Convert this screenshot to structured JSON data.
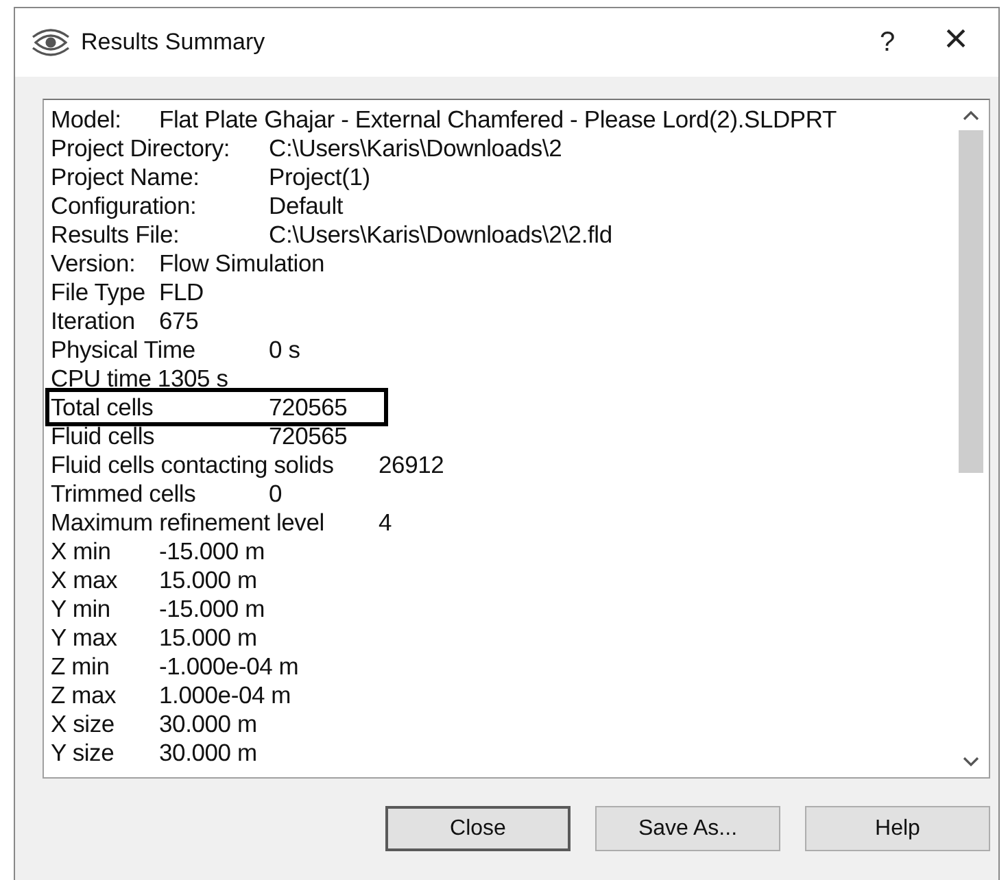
{
  "window": {
    "title": "Results Summary",
    "help": "?",
    "close": "×"
  },
  "results": [
    {
      "label": "Model:",
      "value": "Flat Plate Ghajar - External Chamfered - Please Lord(2).SLDPRT",
      "outlined": false
    },
    {
      "label": "Project Directory:",
      "value": "C:\\Users\\Karis\\Downloads\\2",
      "outlined": false
    },
    {
      "label": "Project Name:",
      "value": "Project(1)",
      "outlined": false
    },
    {
      "label": "Configuration:",
      "value": "Default",
      "outlined": false
    },
    {
      "label": "Results File:",
      "value": "C:\\Users\\Karis\\Downloads\\2\\2.fld",
      "outlined": false
    },
    {
      "label": "Version:",
      "value": "Flow Simulation",
      "outlined": false
    },
    {
      "label": "File Type",
      "value": "FLD",
      "outlined": false
    },
    {
      "label": "Iteration",
      "value": "675",
      "outlined": false
    },
    {
      "label": "Physical Time",
      "value": "0 s",
      "outlined": false
    },
    {
      "label": "CPU time 1305 s",
      "outlined": false
    },
    {
      "label": "Total cells",
      "value": "720565",
      "outlined": true
    },
    {
      "label": "Fluid cells",
      "value": "720565",
      "outlined": false
    },
    {
      "label": "Fluid cells contacting solids",
      "value": "26912",
      "outlined": false
    },
    {
      "label": "Trimmed cells",
      "value": "0",
      "outlined": false
    },
    {
      "label": "Maximum refinement level",
      "value": "4",
      "outlined": false
    },
    {
      "label": "X min",
      "value": "-15.000 m",
      "outlined": false
    },
    {
      "label": "X max",
      "value": "15.000 m",
      "outlined": false
    },
    {
      "label": "Y min",
      "value": "-15.000 m",
      "outlined": false
    },
    {
      "label": "Y max",
      "value": "15.000 m",
      "outlined": false
    },
    {
      "label": "Z min",
      "value": "-1.000e-04 m",
      "outlined": false
    },
    {
      "label": "Z max",
      "value": "1.000e-04 m",
      "outlined": false
    },
    {
      "label": "X size",
      "value": "30.000 m",
      "outlined": false
    },
    {
      "label": "Y size",
      "value": "30.000 m",
      "outlined": false
    }
  ],
  "buttons": [
    {
      "label": "Close",
      "default": true
    },
    {
      "label": "Save As...",
      "default": false
    },
    {
      "label": "Help",
      "default": false
    }
  ]
}
